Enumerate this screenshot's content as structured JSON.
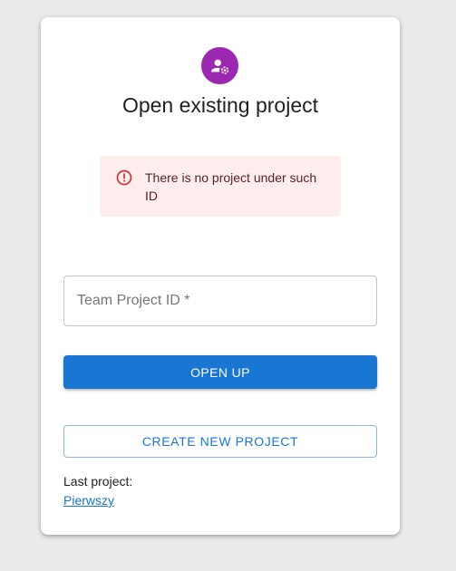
{
  "colors": {
    "avatar_bg": "#9c27b0",
    "alert_bg": "#fdeded",
    "alert_icon": "#d32f2f",
    "primary": "#1976d2",
    "outline_border": "#8bb4e0"
  },
  "header": {
    "avatar_icon": "manage-accounts-icon",
    "title": "Open existing project"
  },
  "alert": {
    "icon": "error-outline-icon",
    "message": "There is no project under such ID"
  },
  "form": {
    "project_id_placeholder": "Team Project ID *",
    "project_id_value": "",
    "open_label": "OPEN UP",
    "create_label": "CREATE NEW PROJECT"
  },
  "last_project": {
    "label": "Last project:",
    "name": "Pierwszy"
  }
}
